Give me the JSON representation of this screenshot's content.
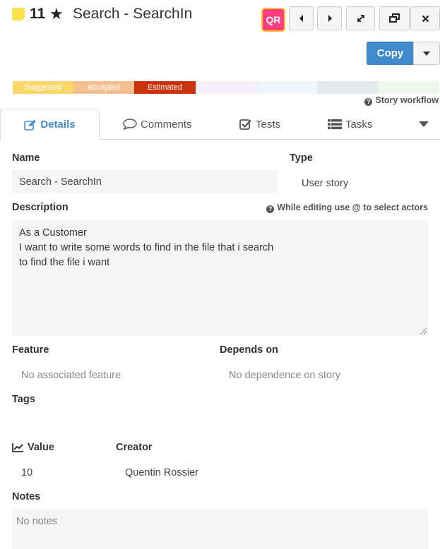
{
  "header": {
    "story_id": "11",
    "title": "Search - SearchIn",
    "qr_label": "QR"
  },
  "toolbar": {
    "copy_label": "Copy"
  },
  "workflow": {
    "states": [
      {
        "label": "Suggested",
        "color": "#f9d76b"
      },
      {
        "label": "Accepted",
        "color": "#f9c08f"
      },
      {
        "label": "Estimated",
        "color": "#c9340b"
      },
      {
        "label": "",
        "color": "#f6f0fb"
      },
      {
        "label": "",
        "color": "#eef5fc"
      },
      {
        "label": "",
        "color": "#e4eaec"
      },
      {
        "label": "",
        "color": "#ecf7ea"
      }
    ],
    "help": "Story workflow"
  },
  "tabs": {
    "details": "Details",
    "comments": "Comments",
    "tests": "Tests",
    "tasks": "Tasks"
  },
  "form": {
    "name_label": "Name",
    "name_value": "Search - SearchIn",
    "type_label": "Type",
    "type_value": "User story",
    "description_label": "Description",
    "description_help": "While editing use @ to select actors",
    "description_lines": [
      "As a Customer",
      "I want to write some words to find in the file that i search",
      "to find the file i want"
    ],
    "feature_label": "Feature",
    "feature_value": "No associated feature",
    "depends_label": "Depends on",
    "depends_value": "No dependence on story",
    "tags_label": "Tags",
    "value_label": "Value",
    "value_value": "10",
    "creator_label": "Creator",
    "creator_value": "Quentin Rossier",
    "notes_label": "Notes",
    "notes_value": "No notes"
  },
  "colors": {
    "accent": "#428bca",
    "qr_bg": "#ff3d7f",
    "qr_border": "#f9c233",
    "sticky": "#f7e34f"
  },
  "icons": [
    "sticky-note-icon",
    "star-icon",
    "chevron-left-icon",
    "chevron-right-icon",
    "expand-icon",
    "window-restore-icon",
    "close-icon",
    "edit-icon",
    "comment-icon",
    "checkbox-icon",
    "list-icon",
    "caret-down-icon",
    "question-circle-icon",
    "chart-line-icon"
  ]
}
